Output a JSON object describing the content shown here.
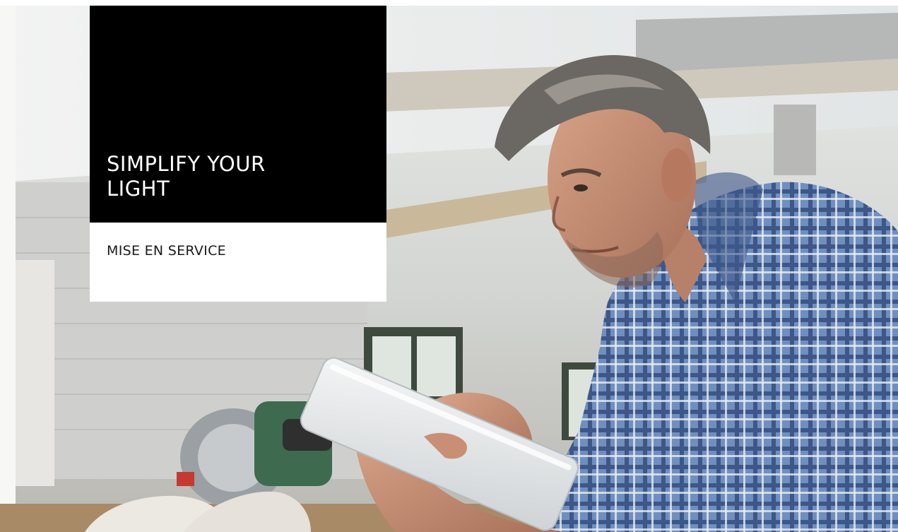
{
  "hero": {
    "title_line1": "SIMPLIFY YOUR",
    "title_line2": "LIGHT",
    "subtitle": "MISE EN SERVICE"
  },
  "photo": {
    "subject": "man-with-tablet",
    "shirt_color": "#6b87b4",
    "background_color": "#d8d9d6"
  }
}
